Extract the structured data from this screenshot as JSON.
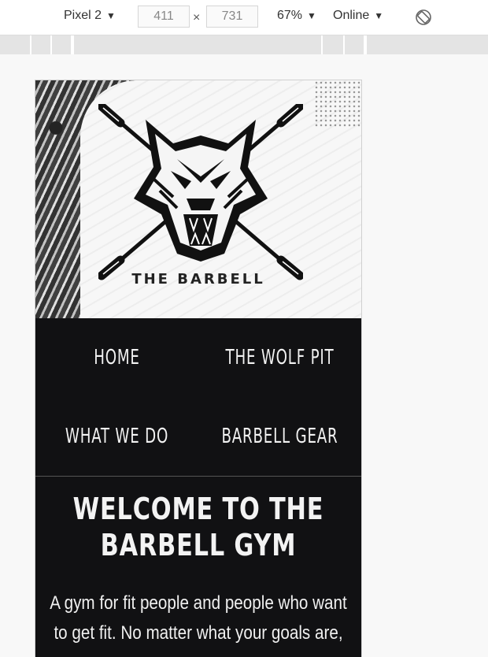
{
  "devtools": {
    "device": "Pixel 2",
    "width": "411",
    "height": "731",
    "times": "×",
    "zoom": "67%",
    "network": "Online",
    "caret": "▼",
    "icons": {
      "dropdown": "caret-down",
      "rotate": "rotate-icon"
    }
  },
  "site": {
    "logo_text": "THE BARBELL",
    "nav": {
      "home": "HOME",
      "wolf_pit": "THE WOLF PIT",
      "what_we_do": "WHAT WE DO",
      "gear": "BARBELL GEAR"
    },
    "heading_line1": "WELCOME TO THE",
    "heading_line2": "BARBELL GYM",
    "intro_line1": "A gym for fit people and people who want",
    "intro_line2": "to get fit. No matter what your goals are,"
  },
  "colors": {
    "page_bg": "#f8f8f8",
    "site_bg": "#111113",
    "site_text": "#f2f2f2",
    "toolbar_bg": "#ffffff"
  }
}
